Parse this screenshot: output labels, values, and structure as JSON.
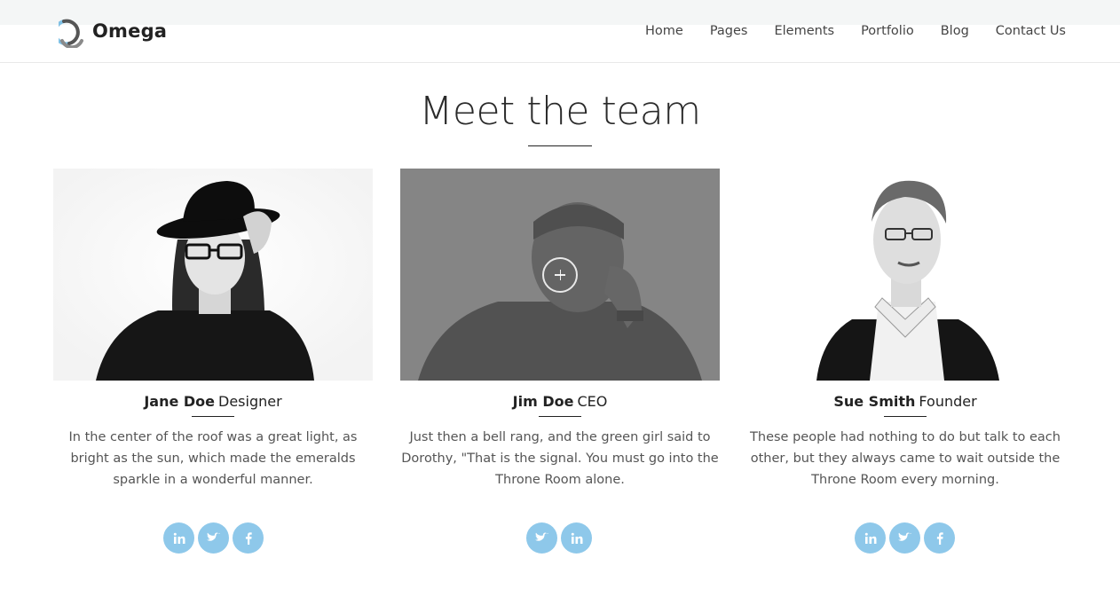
{
  "brand": {
    "name": "Omega",
    "logo_icon": "omega-ring-logo"
  },
  "nav": {
    "items": [
      {
        "label": "Home"
      },
      {
        "label": "Pages"
      },
      {
        "label": "Elements"
      },
      {
        "label": "Portfolio"
      },
      {
        "label": "Blog"
      },
      {
        "label": "Contact Us"
      }
    ]
  },
  "section": {
    "title": "Meet the team"
  },
  "team": [
    {
      "name": "Jane Doe",
      "role": "Designer",
      "bio": "In the center of the roof was a great light, as bright as the sun, which made the emeralds sparkle in a wonderful manner.",
      "socials": [
        "linkedin-icon",
        "twitter-icon",
        "facebook-icon"
      ]
    },
    {
      "name": "Jim Doe",
      "role": "CEO",
      "bio": "Just then a bell rang, and the green girl said to Dorothy, \"That is the signal. You must go into the Throne Room alone.",
      "socials": [
        "twitter-icon",
        "linkedin-icon"
      ]
    },
    {
      "name": "Sue Smith",
      "role": "Founder",
      "bio": "These people had nothing to do but talk to each other, but they always came to wait outside the Throne Room every morning.",
      "socials": [
        "linkedin-icon",
        "twitter-icon",
        "facebook-icon"
      ]
    }
  ],
  "colors": {
    "accent": "#8ec8ea",
    "text": "#333333",
    "muted": "#555555"
  }
}
